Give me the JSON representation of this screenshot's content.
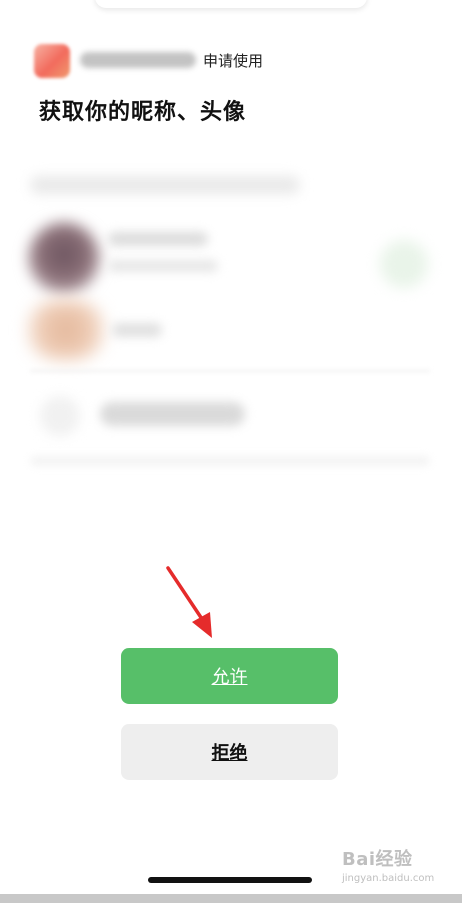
{
  "header": {
    "apply_text": "申请使用",
    "title": "获取你的昵称、头像"
  },
  "buttons": {
    "allow_label": "允许",
    "deny_label": "拒绝"
  },
  "watermark": {
    "logo": "Bai经验",
    "sub": "jingyan.baidu.com"
  },
  "colors": {
    "allow_bg": "#57bf69",
    "deny_bg": "#eeeeee",
    "arrow": "#e52b2b"
  }
}
